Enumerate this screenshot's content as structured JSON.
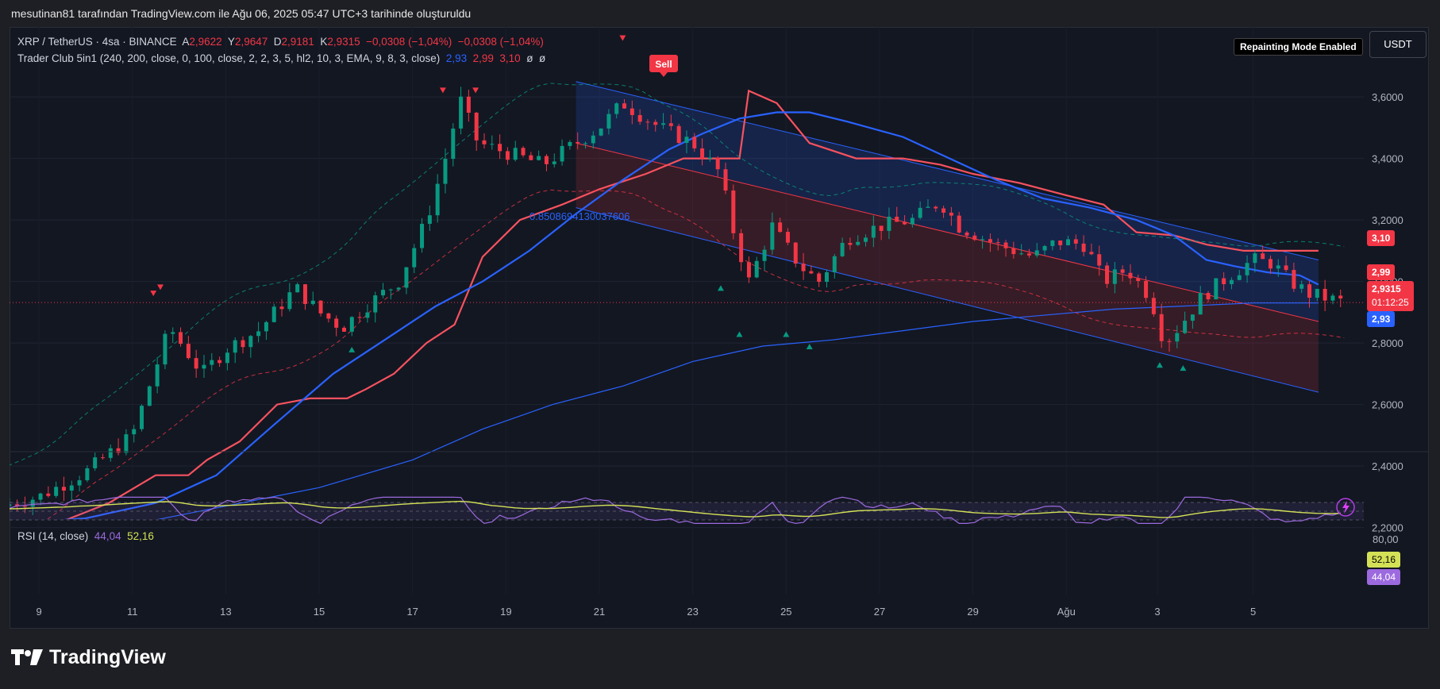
{
  "caption": "mesutinan81 tarafından TradingView.com ile Ağu 06, 2025 05:47 UTC+3 tarihinde oluşturuldu",
  "legend": {
    "symbol": "XRP / TetherUS · 4sa · BINANCE",
    "a_label": "A",
    "a_value": "2,9622",
    "y_label": "Y",
    "y_value": "2,9647",
    "d_label": "D",
    "d_value": "2,9181",
    "k_label": "K",
    "k_value": "2,9315",
    "change": "−0,0308 (−1,04%)",
    "change2": "−0,0308 (−1,04%)"
  },
  "indicator": {
    "name": "Trader Club 5in1 (240, 200, close, 0, 100, close, 2, 2, 3, 5, hl2, 10, 3, EMA, 9, 8, 3, close)",
    "v1": "2,93",
    "v2": "2,99",
    "v3": "3,10",
    "sym1": "ø",
    "sym2": "ø"
  },
  "repainting_label": "Repainting Mode Enabled",
  "currency_button": "USDT",
  "fib_label": "0.8508694130037606",
  "sell_label": "Sell",
  "price_badges": {
    "b310": "3,10",
    "b299": "2,99",
    "b29315": "2,9315",
    "countdown": "01:12:25",
    "b293": "2,93"
  },
  "rsi": {
    "title": "RSI (14, close)",
    "rsi_value": "44,04",
    "ma_value": "52,16",
    "axis_top": "80,00",
    "badge_ma": "52,16",
    "badge_rsi": "44,04"
  },
  "brand": "TradingView",
  "colors": {
    "bull": "#089981",
    "bear": "#f23645",
    "blue": "#2962ff",
    "ema_red": "#f7525f",
    "rsi_purple": "#9c6ade",
    "rsi_yellow": "#d4e157"
  },
  "chart_data": {
    "type": "candlestick",
    "title": "XRP / TetherUS · 4sa · BINANCE",
    "ylim": [
      2.15,
      3.75
    ],
    "y_ticks": [
      "3,6000",
      "3,4000",
      "3,2000",
      "3,0000",
      "2,8000",
      "2,6000",
      "2,4000",
      "2,2000"
    ],
    "x_ticks": [
      "9",
      "11",
      "13",
      "15",
      "17",
      "19",
      "21",
      "23",
      "25",
      "27",
      "29",
      "Ağu",
      "3",
      "5"
    ],
    "x_range_days": [
      8.2,
      37.2
    ],
    "anchors": [
      [
        8.2,
        2.27
      ],
      [
        9.0,
        2.3
      ],
      [
        10.0,
        2.38
      ],
      [
        11.0,
        2.5
      ],
      [
        11.5,
        2.72
      ],
      [
        11.8,
        2.85
      ],
      [
        12.5,
        2.7
      ],
      [
        13.0,
        2.78
      ],
      [
        13.7,
        2.84
      ],
      [
        14.5,
        2.98
      ],
      [
        15.0,
        2.9
      ],
      [
        15.5,
        2.85
      ],
      [
        16.0,
        2.92
      ],
      [
        16.7,
        3.0
      ],
      [
        17.3,
        3.2
      ],
      [
        17.8,
        3.45
      ],
      [
        18.0,
        3.6
      ],
      [
        18.4,
        3.45
      ],
      [
        19.0,
        3.42
      ],
      [
        19.8,
        3.38
      ],
      [
        20.5,
        3.45
      ],
      [
        21.0,
        3.5
      ],
      [
        21.5,
        3.58
      ],
      [
        22.3,
        3.5
      ],
      [
        23.0,
        3.45
      ],
      [
        23.6,
        3.35
      ],
      [
        23.8,
        3.2
      ],
      [
        24.2,
        3.0
      ],
      [
        24.7,
        3.18
      ],
      [
        25.3,
        3.05
      ],
      [
        25.7,
        3.0
      ],
      [
        26.3,
        3.14
      ],
      [
        27.0,
        3.18
      ],
      [
        27.7,
        3.2
      ],
      [
        28.3,
        3.26
      ],
      [
        28.7,
        3.18
      ],
      [
        29.5,
        3.12
      ],
      [
        30.3,
        3.08
      ],
      [
        30.8,
        3.13
      ],
      [
        31.4,
        3.12
      ],
      [
        31.8,
        3.0
      ],
      [
        32.3,
        3.04
      ],
      [
        32.8,
        2.95
      ],
      [
        33.1,
        2.8
      ],
      [
        33.4,
        2.85
      ],
      [
        33.9,
        2.95
      ],
      [
        34.5,
        3.02
      ],
      [
        35.0,
        3.07
      ],
      [
        35.4,
        3.06
      ],
      [
        35.8,
        3.0
      ],
      [
        36.2,
        2.96
      ],
      [
        37.0,
        2.93
      ]
    ],
    "series": [
      {
        "name": "",
        "type": "ema-red",
        "points": [
          [
            8.2,
            2.2
          ],
          [
            9.5,
            2.22
          ],
          [
            10.5,
            2.28
          ],
          [
            11.5,
            2.37
          ],
          [
            12.2,
            2.37
          ],
          [
            12.6,
            2.42
          ],
          [
            13.3,
            2.48
          ],
          [
            14.1,
            2.6
          ],
          [
            14.8,
            2.62
          ],
          [
            15.6,
            2.62
          ],
          [
            16.0,
            2.65
          ],
          [
            16.6,
            2.7
          ],
          [
            17.3,
            2.8
          ],
          [
            17.9,
            2.86
          ],
          [
            18.5,
            3.08
          ],
          [
            19.3,
            3.2
          ],
          [
            20.2,
            3.25
          ],
          [
            21.0,
            3.3
          ],
          [
            22.0,
            3.35
          ],
          [
            22.8,
            3.4
          ],
          [
            23.6,
            3.4
          ],
          [
            24.0,
            3.4
          ],
          [
            24.2,
            3.62
          ],
          [
            24.8,
            3.58
          ],
          [
            25.5,
            3.45
          ],
          [
            26.5,
            3.4
          ],
          [
            27.5,
            3.4
          ],
          [
            28.3,
            3.38
          ],
          [
            29.0,
            3.35
          ],
          [
            30.0,
            3.32
          ],
          [
            31.0,
            3.28
          ],
          [
            31.8,
            3.25
          ],
          [
            32.5,
            3.16
          ],
          [
            33.3,
            3.15
          ],
          [
            34.0,
            3.12
          ],
          [
            34.8,
            3.1
          ],
          [
            35.6,
            3.1
          ],
          [
            36.4,
            3.1
          ]
        ]
      },
      {
        "name": "",
        "type": "ma-blue",
        "points": [
          [
            8.2,
            2.21
          ],
          [
            10.0,
            2.23
          ],
          [
            11.5,
            2.28
          ],
          [
            12.8,
            2.37
          ],
          [
            14.0,
            2.53
          ],
          [
            15.3,
            2.7
          ],
          [
            16.5,
            2.82
          ],
          [
            17.5,
            2.92
          ],
          [
            18.5,
            3.0
          ],
          [
            19.5,
            3.1
          ],
          [
            20.5,
            3.22
          ],
          [
            21.5,
            3.33
          ],
          [
            22.5,
            3.43
          ],
          [
            23.2,
            3.48
          ],
          [
            24.0,
            3.53
          ],
          [
            24.8,
            3.55
          ],
          [
            25.5,
            3.55
          ],
          [
            26.3,
            3.52
          ],
          [
            27.5,
            3.47
          ],
          [
            28.5,
            3.4
          ],
          [
            29.5,
            3.33
          ],
          [
            30.5,
            3.27
          ],
          [
            31.5,
            3.24
          ],
          [
            32.5,
            3.2
          ],
          [
            33.3,
            3.15
          ],
          [
            34.0,
            3.07
          ],
          [
            34.6,
            3.05
          ],
          [
            35.3,
            3.03
          ],
          [
            36.0,
            3.02
          ],
          [
            36.4,
            2.99
          ]
        ]
      },
      {
        "name": "",
        "type": "sma-slow",
        "points": [
          [
            8.2,
            2.19
          ],
          [
            11.0,
            2.21
          ],
          [
            13.0,
            2.27
          ],
          [
            15.0,
            2.33
          ],
          [
            17.0,
            2.42
          ],
          [
            18.5,
            2.52
          ],
          [
            20.0,
            2.6
          ],
          [
            21.5,
            2.66
          ],
          [
            23.0,
            2.74
          ],
          [
            24.5,
            2.79
          ],
          [
            26.0,
            2.81
          ],
          [
            27.5,
            2.84
          ],
          [
            29.0,
            2.87
          ],
          [
            30.5,
            2.89
          ],
          [
            32.0,
            2.91
          ],
          [
            33.5,
            2.92
          ],
          [
            35.0,
            2.93
          ],
          [
            36.4,
            2.93
          ]
        ]
      }
    ],
    "channel": {
      "start_day": 20.5,
      "end_day": 36.4,
      "upper": [
        3.65,
        3.07
      ],
      "mid": [
        3.45,
        2.87
      ],
      "lower": [
        3.24,
        2.64
      ]
    },
    "rsi_series": {
      "rsi_last": 44.04,
      "ma_last": 52.16,
      "band": [
        30,
        70
      ],
      "mid": 50
    }
  }
}
